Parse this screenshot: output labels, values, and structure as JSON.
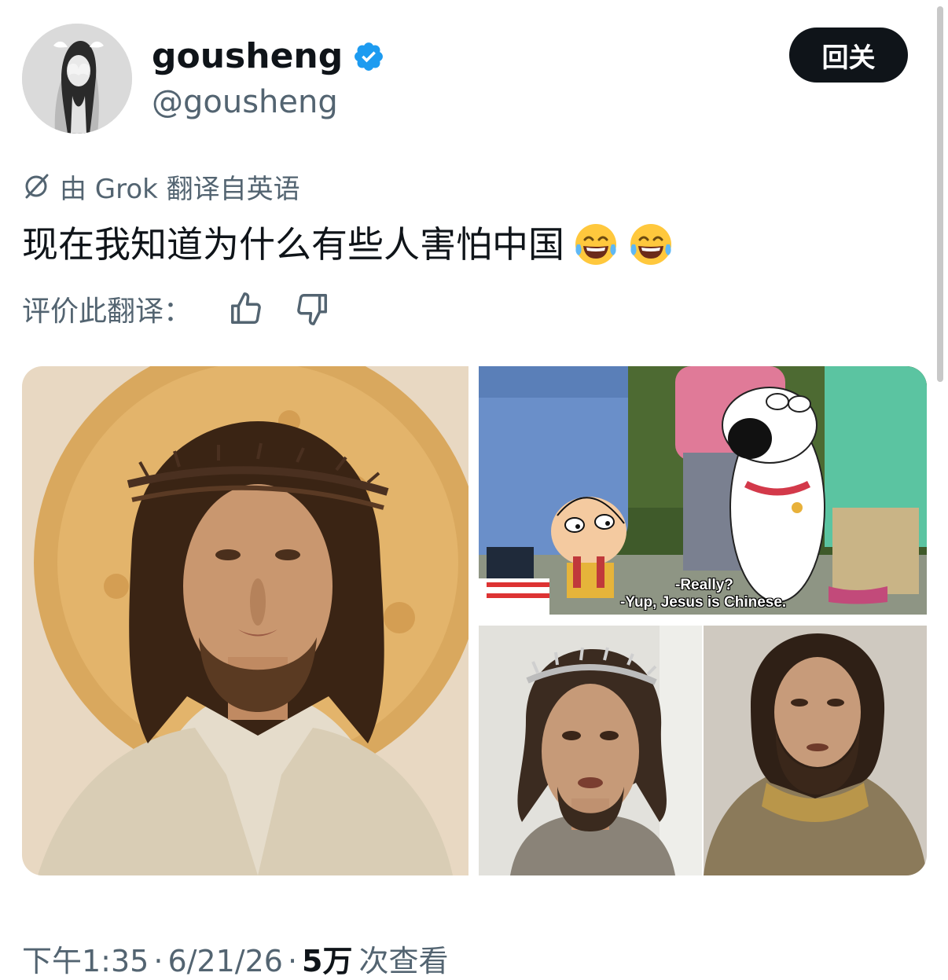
{
  "author": {
    "display_name": "gousheng",
    "handle": "@gousheng",
    "verified": true,
    "verified_color": "#1d9bf0"
  },
  "follow_button": {
    "label": "回关"
  },
  "translation": {
    "note": "由 Grok 翻译自英语",
    "rate_label": "评价此翻译："
  },
  "tweet": {
    "text": "现在我知道为什么有些人害怕中国",
    "emojis": [
      "face-with-tears-of-joy",
      "face-with-tears-of-joy"
    ]
  },
  "media": {
    "captions": [
      "-Really?",
      "-Yup, Jesus is Chinese."
    ]
  },
  "meta": {
    "time": "下午1:35",
    "date": "6/21/26",
    "views_count": "5万",
    "views_label": "次查看"
  },
  "colors": {
    "text_primary": "#0f1419",
    "text_secondary": "#536471",
    "button_bg": "#0f1419"
  }
}
